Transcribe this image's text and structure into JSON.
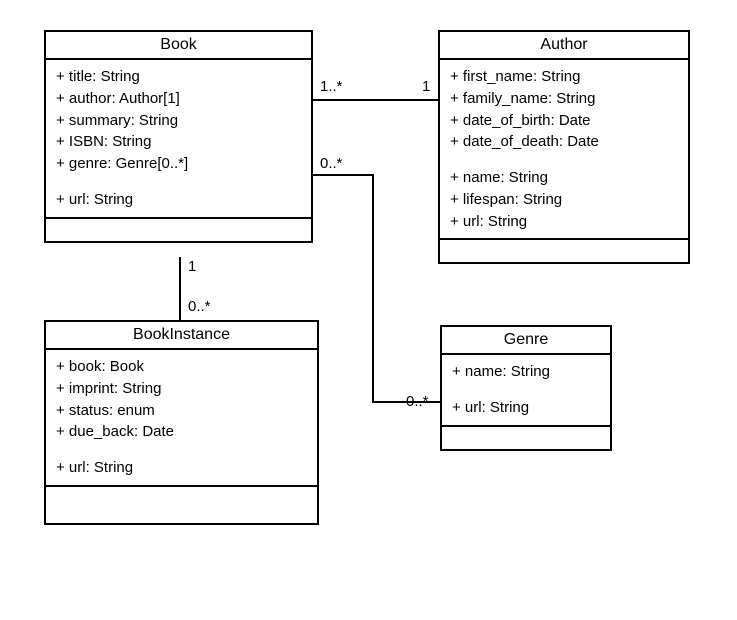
{
  "classes": {
    "book": {
      "name": "Book",
      "attrs": [
        "+ title: String",
        "+ author: Author[1]",
        "+ summary: String",
        "+ ISBN: String",
        "+ genre: Genre[0..*]"
      ],
      "attrs2": [
        "+ url: String"
      ]
    },
    "author": {
      "name": "Author",
      "attrs": [
        "+ first_name: String",
        "+ family_name: String",
        "+ date_of_birth: Date",
        "+ date_of_death: Date"
      ],
      "attrs2": [
        "+ name: String",
        "+ lifespan: String",
        "+ url: String"
      ]
    },
    "bookInstance": {
      "name": "BookInstance",
      "attrs": [
        "+ book: Book",
        "+ imprint: String",
        "+ status: enum",
        "+ due_back: Date"
      ],
      "attrs2": [
        "+ url: String"
      ]
    },
    "genre": {
      "name": "Genre",
      "attrs": [
        "+ name: String"
      ],
      "attrs2": [
        "+ url: String"
      ]
    }
  },
  "mults": {
    "book_author_left": "1..*",
    "book_author_right": "1",
    "book_bookinstance_top": "1",
    "book_bookinstance_bottom": "0..*",
    "book_genre_top": "0..*",
    "book_genre_bottom": "0..*"
  },
  "chart_data": {
    "type": "uml-class-diagram",
    "classes": [
      {
        "name": "Book",
        "attributes": [
          "+ title: String",
          "+ author: Author[1]",
          "+ summary: String",
          "+ ISBN: String",
          "+ genre: Genre[0..*]",
          "+ url: String"
        ],
        "operations": []
      },
      {
        "name": "Author",
        "attributes": [
          "+ first_name: String",
          "+ family_name: String",
          "+ date_of_birth: Date",
          "+ date_of_death: Date",
          "+ name: String",
          "+ lifespan: String",
          "+ url: String"
        ],
        "operations": []
      },
      {
        "name": "BookInstance",
        "attributes": [
          "+ book: Book",
          "+ imprint: String",
          "+ status: enum",
          "+ due_back: Date",
          "+ url: String"
        ],
        "operations": []
      },
      {
        "name": "Genre",
        "attributes": [
          "+ name: String",
          "+ url: String"
        ],
        "operations": []
      }
    ],
    "relationships": [
      {
        "from": "Book",
        "to": "Author",
        "from_mult": "1..*",
        "to_mult": "1",
        "type": "association"
      },
      {
        "from": "Book",
        "to": "BookInstance",
        "from_mult": "1",
        "to_mult": "0..*",
        "type": "association"
      },
      {
        "from": "Book",
        "to": "Genre",
        "from_mult": "0..*",
        "to_mult": "0..*",
        "type": "association"
      }
    ]
  }
}
